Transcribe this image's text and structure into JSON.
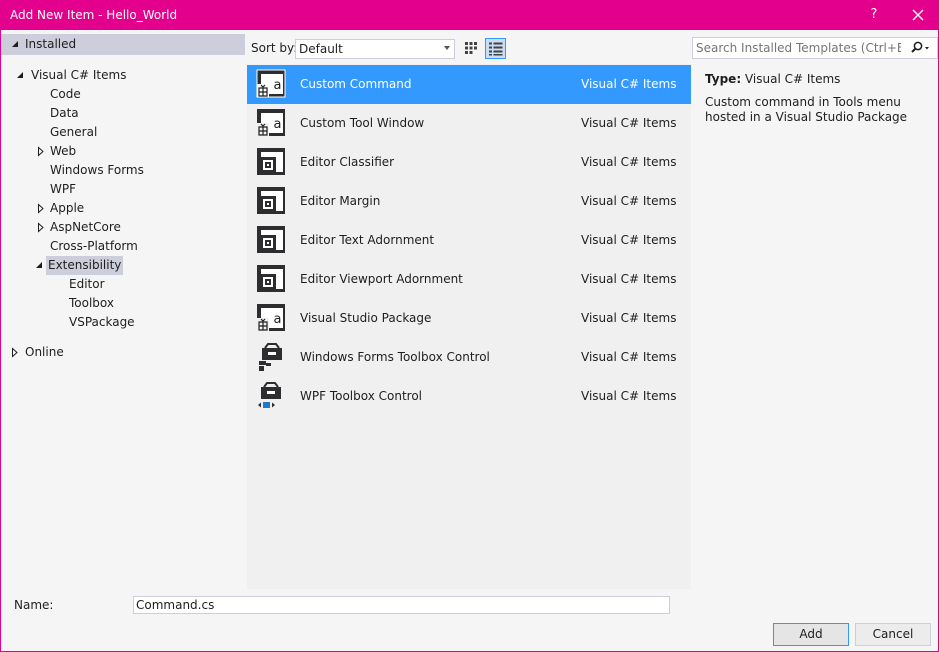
{
  "window": {
    "title": "Add New Item - Hello_World",
    "help_label": "?",
    "accent_color": "#e3008c"
  },
  "tree": {
    "installed": "Installed",
    "visual_csharp_items": "Visual C# Items",
    "code": "Code",
    "data": "Data",
    "general": "General",
    "web": "Web",
    "windows_forms": "Windows Forms",
    "wpf": "WPF",
    "apple": "Apple",
    "aspnetcore": "AspNetCore",
    "cross_platform": "Cross-Platform",
    "extensibility": "Extensibility",
    "editor": "Editor",
    "toolbox": "Toolbox",
    "vspackage": "VSPackage",
    "online": "Online"
  },
  "toolbar": {
    "sort_label": "Sort by:",
    "sort_value": "Default"
  },
  "search": {
    "placeholder": "Search Installed Templates (Ctrl+E)"
  },
  "templates": [
    {
      "name": "Custom Command",
      "category": "Visual C# Items",
      "icon": "package-item-icon",
      "selected": true
    },
    {
      "name": "Custom Tool Window",
      "category": "Visual C# Items",
      "icon": "package-item-icon"
    },
    {
      "name": "Editor Classifier",
      "category": "Visual C# Items",
      "icon": "editor-item-icon"
    },
    {
      "name": "Editor Margin",
      "category": "Visual C# Items",
      "icon": "editor-item-icon"
    },
    {
      "name": "Editor Text Adornment",
      "category": "Visual C# Items",
      "icon": "editor-item-icon"
    },
    {
      "name": "Editor Viewport Adornment",
      "category": "Visual C# Items",
      "icon": "editor-item-icon"
    },
    {
      "name": "Visual Studio Package",
      "category": "Visual C# Items",
      "icon": "package-item-icon"
    },
    {
      "name": "Windows Forms Toolbox Control",
      "category": "Visual C# Items",
      "icon": "winforms-toolbox-icon"
    },
    {
      "name": "WPF Toolbox Control",
      "category": "Visual C# Items",
      "icon": "wpf-toolbox-icon"
    }
  ],
  "details": {
    "type_label": "Type:",
    "type_value": "Visual C# Items",
    "description": "Custom command in Tools menu hosted in a Visual Studio Package"
  },
  "footer": {
    "name_label": "Name:",
    "name_value": "Command.cs",
    "add_label": "Add",
    "cancel_label": "Cancel"
  },
  "colors": {
    "selection": "#3399ff",
    "tree_selection": "#cccedb"
  }
}
